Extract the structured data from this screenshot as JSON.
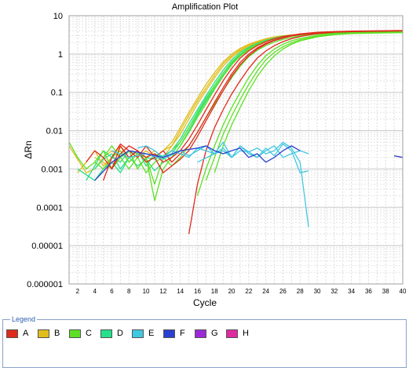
{
  "chart_data": {
    "type": "line",
    "title": "Amplification Plot",
    "xlabel": "Cycle",
    "ylabel": "ΔRn",
    "xlim": [
      1,
      40
    ],
    "ylim": [
      1e-06,
      10
    ],
    "yscale": "log",
    "grid": true,
    "x_ticks": [
      2,
      4,
      6,
      8,
      10,
      12,
      14,
      16,
      18,
      20,
      22,
      24,
      26,
      28,
      30,
      32,
      34,
      36,
      38,
      40
    ],
    "y_ticks": [
      1e-06,
      1e-05,
      0.0001,
      0.001,
      0.01,
      0.1,
      1,
      10
    ],
    "y_tick_labels": [
      "0.000001",
      "0.00001",
      "0.0001",
      "0.001",
      "0.01",
      "0.1",
      "1",
      "10"
    ],
    "legend": {
      "title": "Legend",
      "placement": "bottom",
      "entries": [
        "A",
        "B",
        "C",
        "D",
        "E",
        "F",
        "G",
        "H"
      ]
    },
    "colors": {
      "A": "#e02a1c",
      "B": "#e0bd1c",
      "C": "#5de024",
      "D": "#24e08a",
      "E": "#40c8e0",
      "F": "#2a40d0",
      "G": "#9a2ad8",
      "H": "#e02aa0"
    },
    "series": [
      {
        "group": "B",
        "x": [
          1,
          3,
          4,
          5,
          6,
          7,
          8,
          9,
          10,
          11,
          12,
          13,
          14,
          15,
          16,
          17,
          18,
          19,
          20,
          21,
          22,
          23,
          24,
          25,
          26,
          27,
          28,
          30,
          32,
          34,
          36,
          38,
          40
        ],
        "y": [
          0.004,
          0.0008,
          0.001,
          0.002,
          0.003,
          0.002,
          0.003,
          0.002,
          0.003,
          0.002,
          0.003,
          0.005,
          0.012,
          0.03,
          0.07,
          0.16,
          0.33,
          0.62,
          1.0,
          1.4,
          1.8,
          2.15,
          2.5,
          2.8,
          3.0,
          3.15,
          3.3,
          3.5,
          3.6,
          3.7,
          3.75,
          3.8,
          3.85
        ]
      },
      {
        "group": "B",
        "x": [
          2,
          3,
          4,
          5,
          6,
          7,
          8,
          9,
          10,
          11,
          12,
          13,
          14,
          15,
          16,
          17,
          18,
          19,
          20,
          21,
          22,
          23,
          24,
          25,
          26,
          27,
          28,
          30,
          32,
          34,
          36,
          38,
          40
        ],
        "y": [
          0.0008,
          0.0015,
          0.003,
          0.0012,
          0.002,
          0.004,
          0.0015,
          0.0025,
          0.002,
          0.003,
          0.002,
          0.004,
          0.01,
          0.025,
          0.06,
          0.13,
          0.28,
          0.55,
          0.9,
          1.3,
          1.7,
          2.05,
          2.4,
          2.7,
          2.95,
          3.1,
          3.25,
          3.45,
          3.55,
          3.65,
          3.7,
          3.75,
          3.8
        ]
      },
      {
        "group": "B",
        "x": [
          4,
          5,
          6,
          7,
          8,
          9,
          10,
          11,
          12,
          13,
          14,
          15,
          16,
          17,
          18,
          19,
          20,
          21,
          22,
          23,
          24,
          25,
          26,
          27,
          28,
          30,
          32,
          34,
          36,
          38,
          40
        ],
        "y": [
          0.002,
          0.0015,
          0.001,
          0.0025,
          0.002,
          0.003,
          0.0015,
          0.002,
          0.003,
          0.004,
          0.008,
          0.02,
          0.05,
          0.11,
          0.24,
          0.48,
          0.82,
          1.2,
          1.6,
          1.95,
          2.3,
          2.6,
          2.85,
          3.05,
          3.2,
          3.4,
          3.5,
          3.6,
          3.65,
          3.7,
          3.75
        ]
      },
      {
        "group": "D",
        "x": [
          3,
          4,
          5,
          6,
          7,
          8,
          9,
          10,
          11,
          12,
          13,
          14,
          15,
          16,
          17,
          18,
          19,
          20,
          21,
          22,
          23,
          24,
          25,
          26,
          27,
          28,
          30,
          32,
          34,
          36,
          38,
          40
        ],
        "y": [
          0.0005,
          0.0012,
          0.003,
          0.002,
          0.0015,
          0.003,
          0.0025,
          0.002,
          0.0018,
          0.0022,
          0.003,
          0.006,
          0.015,
          0.035,
          0.08,
          0.18,
          0.38,
          0.7,
          1.1,
          1.5,
          1.9,
          2.3,
          2.6,
          2.9,
          3.1,
          3.25,
          3.5,
          3.65,
          3.75,
          3.8,
          3.85,
          3.9
        ]
      },
      {
        "group": "D",
        "x": [
          4,
          5,
          6,
          7,
          8,
          9,
          10,
          11,
          12,
          13,
          14,
          15,
          16,
          17,
          18,
          19,
          20,
          21,
          22,
          23,
          24,
          25,
          26,
          27,
          28,
          30,
          32,
          34,
          36,
          38,
          40
        ],
        "y": [
          0.001,
          0.0018,
          0.0025,
          0.001,
          0.002,
          0.003,
          0.0012,
          0.0025,
          0.002,
          0.0025,
          0.005,
          0.012,
          0.03,
          0.07,
          0.15,
          0.32,
          0.6,
          0.98,
          1.4,
          1.8,
          2.2,
          2.5,
          2.8,
          3.0,
          3.2,
          3.45,
          3.6,
          3.7,
          3.75,
          3.8,
          3.85
        ]
      },
      {
        "group": "D",
        "x": [
          2,
          4,
          5,
          6,
          7,
          8,
          9,
          10,
          11,
          12,
          13,
          14,
          15,
          16,
          17,
          18,
          19,
          20,
          21,
          22,
          23,
          24,
          25,
          26,
          27,
          28,
          30,
          32,
          34,
          36,
          38,
          40
        ],
        "y": [
          0.001,
          0.0005,
          0.001,
          0.0015,
          0.0008,
          0.002,
          0.0012,
          0.0018,
          0.0009,
          0.0015,
          0.002,
          0.004,
          0.01,
          0.025,
          0.058,
          0.13,
          0.28,
          0.55,
          0.92,
          1.35,
          1.75,
          2.15,
          2.45,
          2.75,
          2.95,
          3.15,
          3.4,
          3.55,
          3.65,
          3.7,
          3.75,
          3.8
        ]
      },
      {
        "group": "C",
        "x": [
          1,
          2,
          3,
          4,
          5,
          6,
          7,
          8,
          9,
          10,
          11,
          12,
          13,
          14,
          15,
          16,
          17,
          18,
          19,
          20,
          21,
          22,
          23,
          24,
          25,
          26,
          27,
          28,
          30,
          32,
          34,
          36,
          38,
          40
        ],
        "y": [
          0.005,
          0.002,
          0.001,
          0.0015,
          0.003,
          0.001,
          0.002,
          0.001,
          0.002,
          0.0008,
          0.0015,
          0.002,
          0.003,
          0.005,
          0.012,
          0.028,
          0.065,
          0.15,
          0.32,
          0.62,
          1.0,
          1.4,
          1.8,
          2.2,
          2.5,
          2.8,
          3.0,
          3.2,
          3.45,
          3.6,
          3.7,
          3.75,
          3.8,
          3.85
        ]
      },
      {
        "group": "C",
        "x": [
          4,
          5,
          6,
          7,
          8,
          9,
          10,
          11,
          12,
          13,
          14,
          15,
          16,
          17,
          18,
          19,
          20,
          21,
          22,
          23,
          24,
          25,
          26,
          27,
          28,
          30,
          32,
          34,
          36,
          38,
          40
        ],
        "y": [
          0.0015,
          0.001,
          0.002,
          0.003,
          0.0015,
          0.0025,
          0.002,
          0.00015,
          0.001,
          0.002,
          0.004,
          0.009,
          0.022,
          0.05,
          0.12,
          0.26,
          0.52,
          0.88,
          1.3,
          1.7,
          2.1,
          2.45,
          2.75,
          2.95,
          3.15,
          3.4,
          3.55,
          3.65,
          3.7,
          3.75,
          3.8
        ]
      },
      {
        "group": "C",
        "x": [
          5,
          6,
          7,
          8,
          9,
          10,
          11,
          12,
          13,
          14,
          15,
          16,
          17,
          18,
          19,
          20,
          21,
          22,
          23,
          24,
          25,
          26,
          27,
          28,
          30,
          32,
          34,
          36,
          38,
          40
        ],
        "y": [
          0.002,
          0.004,
          0.002,
          0.003,
          0.001,
          0.002,
          0.0004,
          0.002,
          0.0012,
          0.002,
          0.004,
          0.009,
          0.022,
          0.05,
          0.11,
          0.24,
          0.48,
          0.85,
          1.25,
          1.65,
          2.05,
          2.4,
          2.7,
          2.95,
          3.3,
          3.5,
          3.6,
          3.7,
          3.75,
          3.8
        ]
      },
      {
        "group": "C",
        "x": [
          16,
          17,
          18,
          19,
          20,
          21,
          22,
          23,
          24,
          25,
          26,
          27,
          28,
          30,
          32,
          34,
          36,
          38,
          40
        ],
        "y": [
          0.0002,
          0.001,
          0.004,
          0.014,
          0.04,
          0.1,
          0.24,
          0.5,
          0.9,
          1.35,
          1.8,
          2.2,
          2.55,
          3.05,
          3.35,
          3.5,
          3.6,
          3.65,
          3.7
        ]
      },
      {
        "group": "C",
        "x": [
          17,
          18,
          19,
          20,
          21,
          22,
          23,
          24,
          25,
          26,
          27,
          28,
          30,
          32,
          34,
          36,
          38,
          40
        ],
        "y": [
          0.0005,
          0.002,
          0.008,
          0.024,
          0.065,
          0.16,
          0.36,
          0.7,
          1.1,
          1.55,
          1.95,
          2.35,
          2.9,
          3.25,
          3.45,
          3.55,
          3.6,
          3.65
        ]
      },
      {
        "group": "C",
        "x": [
          18,
          19,
          20,
          21,
          22,
          23,
          24,
          25,
          26,
          27,
          28,
          30,
          32,
          34,
          36,
          38,
          40
        ],
        "y": [
          0.0008,
          0.004,
          0.014,
          0.04,
          0.11,
          0.26,
          0.52,
          0.9,
          1.35,
          1.8,
          2.2,
          2.8,
          3.2,
          3.4,
          3.5,
          3.55,
          3.6
        ]
      },
      {
        "group": "A",
        "x": [
          3,
          4,
          5,
          6,
          7,
          8,
          9,
          10,
          11,
          12,
          13,
          14,
          15,
          16,
          17,
          18,
          19,
          20,
          21,
          22,
          23,
          24,
          25,
          26,
          27,
          28,
          30,
          32,
          34,
          36,
          38,
          40
        ],
        "y": [
          0.0015,
          0.003,
          0.002,
          0.001,
          0.004,
          0.002,
          0.003,
          0.0015,
          0.002,
          0.0008,
          0.0012,
          0.0018,
          0.003,
          0.007,
          0.018,
          0.045,
          0.11,
          0.26,
          0.52,
          0.9,
          1.35,
          1.8,
          2.25,
          2.6,
          2.95,
          3.2,
          3.55,
          3.75,
          3.85,
          3.9,
          3.95,
          4.0
        ]
      },
      {
        "group": "A",
        "x": [
          5,
          6,
          7,
          8,
          9,
          10,
          11,
          12,
          13,
          14,
          15,
          16,
          17,
          18,
          19,
          20,
          21,
          22,
          23,
          24,
          25,
          26,
          27,
          28,
          30,
          32,
          34,
          36,
          38,
          40
        ],
        "y": [
          0.0005,
          0.002,
          0.0045,
          0.003,
          0.002,
          0.004,
          0.002,
          0.003,
          0.0015,
          0.0025,
          0.004,
          0.009,
          0.022,
          0.055,
          0.13,
          0.3,
          0.6,
          1.0,
          1.45,
          1.9,
          2.3,
          2.65,
          3.0,
          3.25,
          3.6,
          3.8,
          3.9,
          3.95,
          4.0,
          4.05
        ]
      },
      {
        "group": "A",
        "x": [
          6,
          7,
          8,
          9,
          10,
          11,
          12,
          13,
          14,
          15,
          16,
          17,
          18,
          19,
          20,
          21,
          22,
          23,
          24,
          25,
          26,
          27,
          28,
          30,
          32,
          34,
          36,
          38,
          40
        ],
        "y": [
          0.001,
          0.0025,
          0.004,
          0.003,
          0.002,
          0.0025,
          0.0015,
          0.002,
          0.003,
          0.006,
          0.014,
          0.035,
          0.085,
          0.2,
          0.42,
          0.78,
          1.2,
          1.65,
          2.1,
          2.5,
          2.85,
          3.1,
          3.35,
          3.7,
          3.85,
          3.95,
          4.0,
          4.05,
          4.1
        ]
      },
      {
        "group": "A",
        "x": [
          15,
          16,
          17,
          18,
          19,
          20,
          21,
          22,
          23,
          24,
          25,
          26,
          27,
          28,
          30,
          32,
          34,
          36,
          38,
          40
        ],
        "y": [
          2e-05,
          0.0004,
          0.003,
          0.012,
          0.035,
          0.09,
          0.2,
          0.42,
          0.78,
          1.2,
          1.65,
          2.1,
          2.5,
          2.85,
          3.4,
          3.7,
          3.85,
          3.95,
          4.0,
          4.05
        ]
      },
      {
        "group": "E",
        "x": [
          6,
          8,
          10,
          12,
          14,
          15,
          16,
          17,
          18,
          19,
          20,
          21,
          22,
          23,
          24,
          25,
          26,
          27,
          28,
          29
        ],
        "y": [
          0.003,
          0.002,
          0.0025,
          0.0018,
          0.003,
          0.0022,
          0.003,
          0.004,
          0.0025,
          0.0035,
          0.002,
          0.003,
          0.0028,
          0.0035,
          0.0025,
          0.003,
          0.005,
          0.0035,
          0.0015,
          3e-05
        ]
      },
      {
        "group": "E",
        "x": [
          9,
          10,
          11,
          12,
          13,
          14,
          15,
          16,
          17,
          18,
          19,
          20,
          21,
          22,
          23,
          24,
          25,
          26,
          27,
          28,
          29
        ],
        "y": [
          0.0035,
          0.004,
          0.003,
          0.002,
          0.003,
          0.0025,
          0.002,
          0.0035,
          0.003,
          0.0025,
          0.003,
          0.002,
          0.004,
          0.0025,
          0.002,
          0.003,
          0.004,
          0.002,
          0.0025,
          0.003,
          0.0025
        ]
      },
      {
        "group": "E",
        "x": [
          16,
          18,
          19,
          20,
          21,
          22,
          23,
          24,
          25,
          26,
          27,
          28,
          29
        ],
        "y": [
          0.0015,
          0.0025,
          0.005,
          0.002,
          0.004,
          0.0028,
          0.002,
          0.0035,
          0.0022,
          0.0045,
          0.003,
          0.0008,
          0.0009
        ]
      },
      {
        "group": "F",
        "x": [
          4,
          6,
          8,
          10,
          12,
          14,
          16,
          17,
          18,
          19,
          20,
          21,
          22,
          23,
          24,
          25,
          26,
          27,
          28
        ],
        "y": [
          0.0005,
          0.0015,
          0.003,
          0.0025,
          0.002,
          0.003,
          0.0035,
          0.004,
          0.003,
          0.0025,
          0.003,
          0.0035,
          0.002,
          0.0025,
          0.0015,
          0.002,
          0.003,
          0.004,
          0.003
        ]
      },
      {
        "group": "F",
        "x": [
          39,
          40
        ],
        "y": [
          0.0022,
          0.002
        ]
      }
    ]
  }
}
